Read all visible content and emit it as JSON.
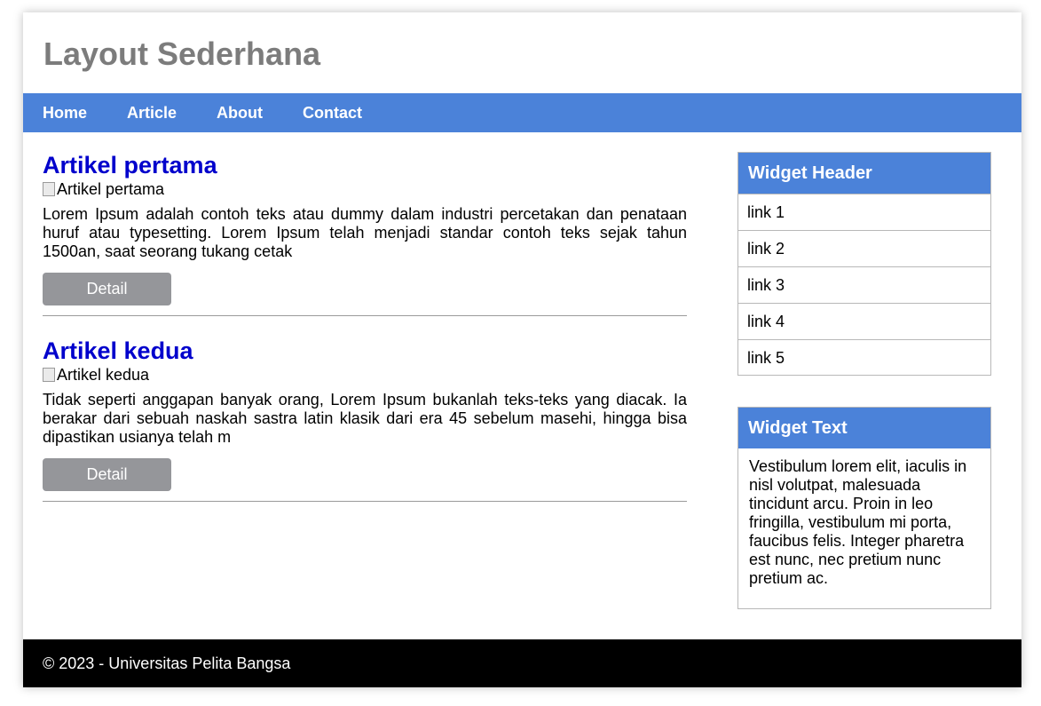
{
  "header": {
    "title": "Layout Sederhana"
  },
  "nav": {
    "items": [
      "Home",
      "Article",
      "About",
      "Contact"
    ]
  },
  "articles": [
    {
      "title": "Artikel pertama",
      "image_alt": "Artikel pertama",
      "text": "Lorem Ipsum adalah contoh teks atau dummy dalam industri percetakan dan penataan huruf atau typesetting. Lorem Ipsum telah menjadi standar contoh teks sejak tahun 1500an, saat seorang tukang cetak",
      "button": "Detail"
    },
    {
      "title": "Artikel kedua",
      "image_alt": "Artikel kedua",
      "text": "Tidak seperti anggapan banyak orang, Lorem Ipsum bukanlah teks-teks yang diacak. Ia berakar dari sebuah naskah sastra latin klasik dari era 45 sebelum masehi, hingga bisa dipastikan usianya telah m",
      "button": "Detail"
    }
  ],
  "sidebar": {
    "widget_links": {
      "header": "Widget Header",
      "links": [
        "link 1",
        "link 2",
        "link 3",
        "link 4",
        "link 5"
      ]
    },
    "widget_text": {
      "header": "Widget Text",
      "body": "Vestibulum lorem elit, iaculis in nisl volutpat, malesuada tincidunt arcu. Proin in leo fringilla, vestibulum mi porta, faucibus felis. Integer pharetra est nunc, nec pretium nunc pretium ac."
    }
  },
  "footer": {
    "text": "© 2023 - Universitas Pelita Bangsa"
  },
  "colors": {
    "nav_background": "#4b82d9",
    "article_title": "#0000cc",
    "button_background": "#95969a",
    "footer_background": "#000000",
    "site_title": "#7c7c7c"
  }
}
